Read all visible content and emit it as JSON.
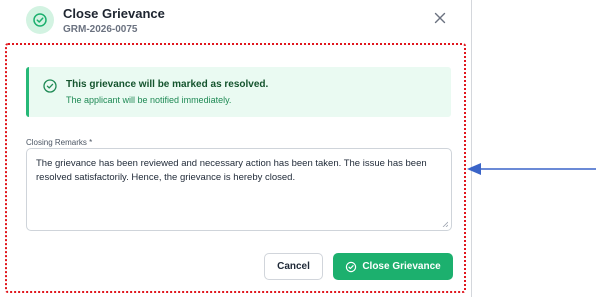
{
  "header": {
    "title": "Close Grievance",
    "reference": "GRM-2026-0075"
  },
  "alert": {
    "title": "This grievance will be marked as resolved.",
    "message": "The applicant will be notified immediately."
  },
  "form": {
    "remarks_label": "Closing Remarks *",
    "remarks_value": "The grievance has been reviewed and necessary action has been taken. The issue has been resolved satisfactorily. Hence, the grievance is hereby closed."
  },
  "footer": {
    "cancel_label": "Cancel",
    "confirm_label": "Close Grievance"
  },
  "icons": {
    "header": "check-circle-icon",
    "close": "close-icon",
    "alert": "check-circle-icon",
    "confirm": "check-circle-icon",
    "annotation": "arrow-left-icon"
  },
  "colors": {
    "accent": "#1cb06e",
    "alert_bg": "#eafaf2",
    "highlight_border": "#e0161d",
    "annotation_arrow": "#3a64c8"
  }
}
